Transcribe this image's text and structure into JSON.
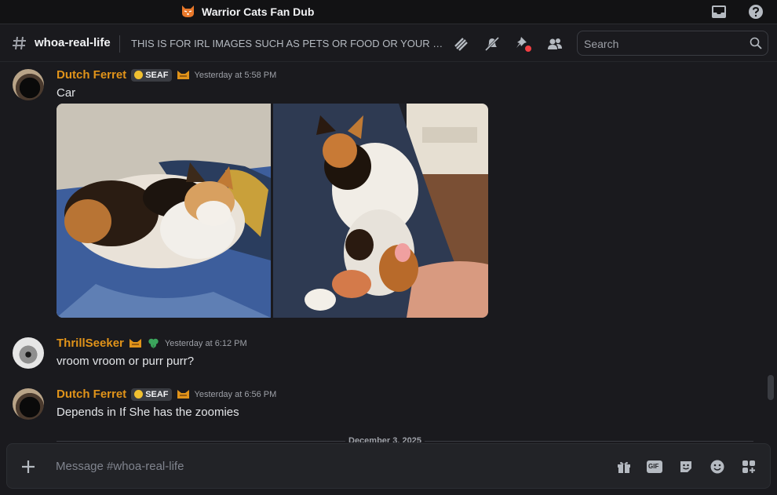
{
  "titlebar": {
    "server_name": "Warrior Cats Fan Dub",
    "server_icon": "cat-face-icon",
    "buttons": [
      "inbox-icon",
      "help-icon"
    ]
  },
  "channel_header": {
    "name": "whoa-real-life",
    "topic": "THIS IS FOR IRL IMAGES SUCH AS PETS OR FOOD OR YOUR FA...",
    "buttons": [
      "threads-icon",
      "mute-icon",
      "pinned-icon",
      "members-icon"
    ],
    "search_placeholder": "Search"
  },
  "messages": [
    {
      "username": "Dutch Ferret",
      "tag": "SEAF",
      "timestamp": "Yesterday at 5:58 PM",
      "text": "Car",
      "attachments": [
        "photo-calico-cat-sleeping",
        "photo-calico-cat-lap"
      ]
    },
    {
      "username": "ThrillSeeker",
      "timestamp": "Yesterday at 6:12 PM",
      "text": "vroom vroom or purr purr?"
    },
    {
      "username": "Dutch Ferret",
      "tag": "SEAF",
      "timestamp": "Yesterday at 6:56 PM",
      "text": "Depends in If She has the zoomies"
    }
  ],
  "date_divider": "December 3, 2025",
  "composer": {
    "placeholder": "Message #whoa-real-life",
    "buttons": [
      "gift-icon",
      "gif-icon",
      "sticker-icon",
      "emoji-icon",
      "apps-icon"
    ],
    "gif_label": "GIF"
  },
  "colors": {
    "background": "#1a1a1e",
    "username": "#e0931a",
    "text": "#e3e5e8",
    "muted": "#9da0a7",
    "unread_dot": "#f23f43",
    "badge_green": "#3ba55c"
  }
}
